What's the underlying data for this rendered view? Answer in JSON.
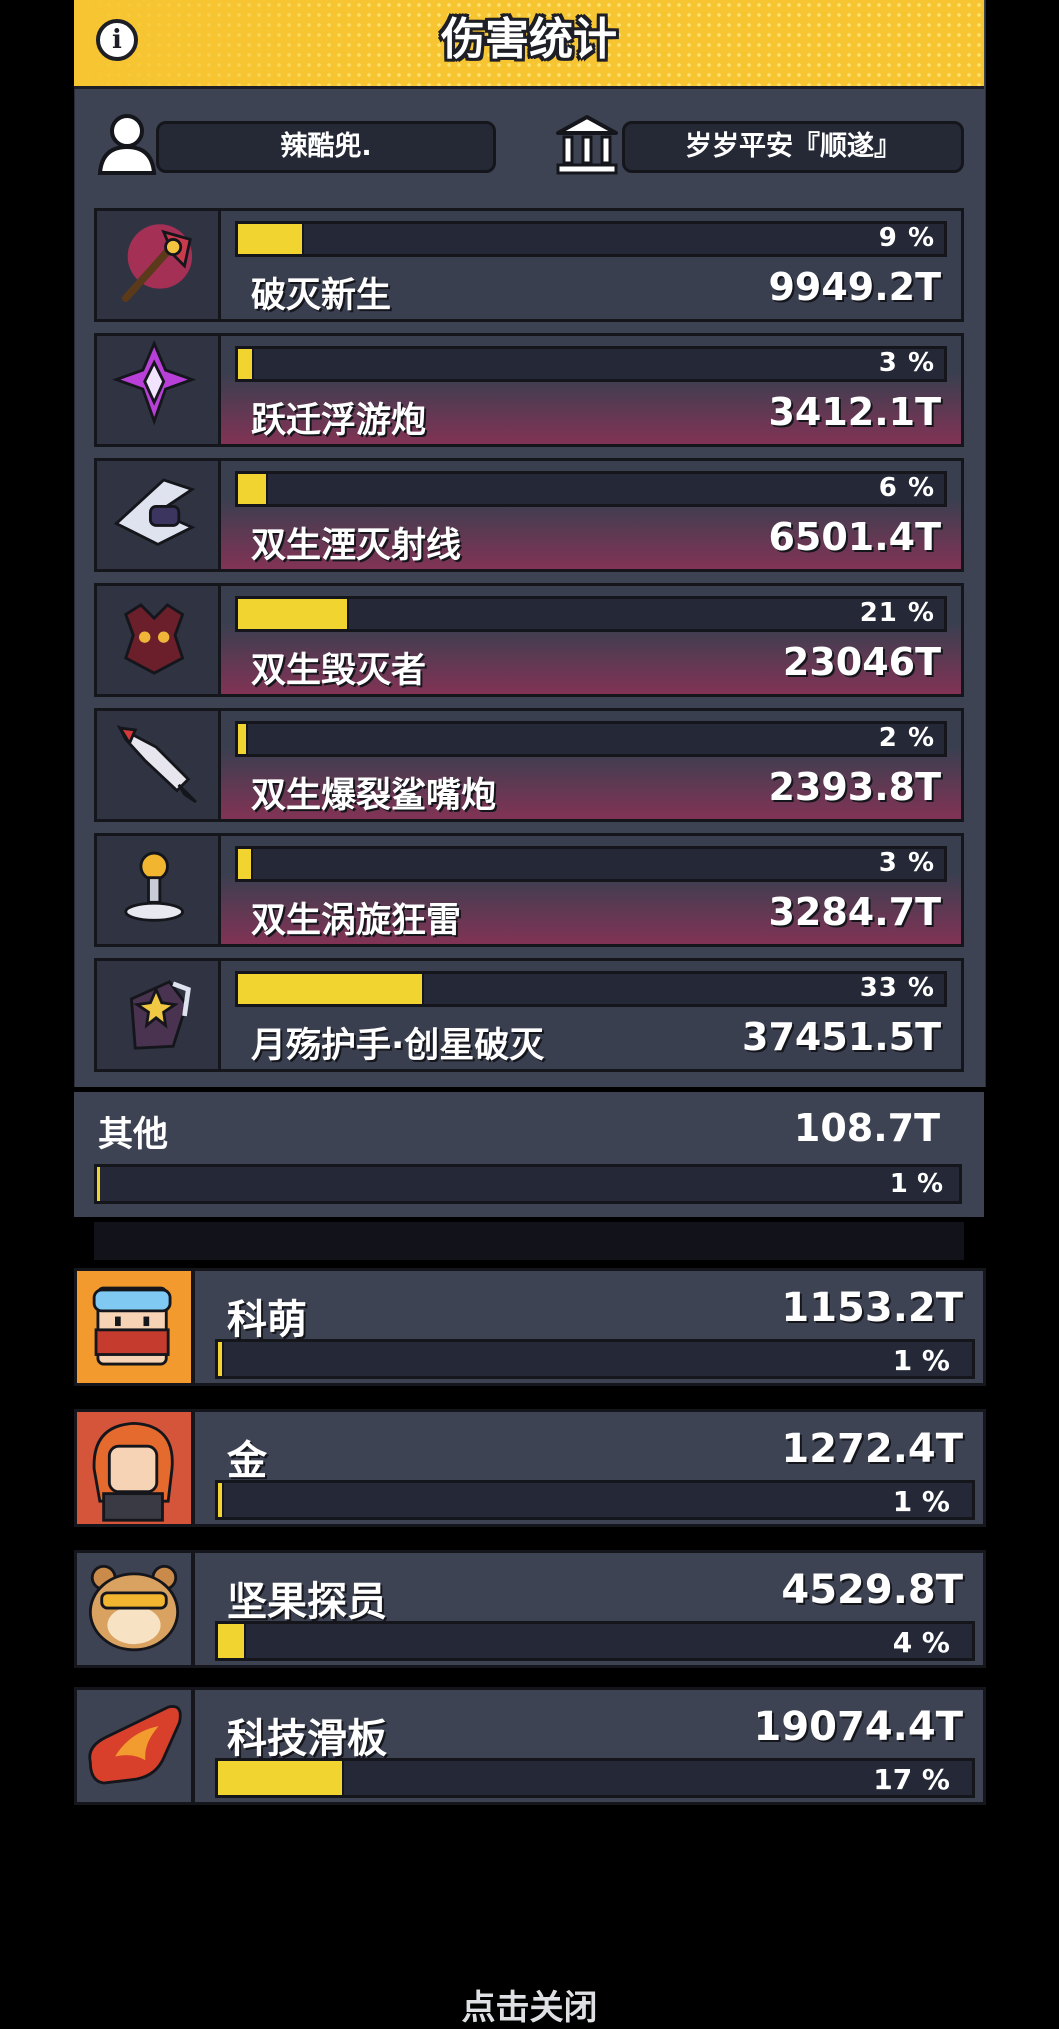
{
  "header": {
    "title": "伤害统计",
    "info_icon": "info-icon"
  },
  "player": {
    "name": "辣酷兜.",
    "guild": "岁岁平安『顺遂』"
  },
  "colors": {
    "header": "#f6c531",
    "bar_fill": "#f1d430",
    "panel": "#3e4354",
    "accent_red": "#823355"
  },
  "skills": [
    {
      "name": "破灭新生",
      "damage": "9949.2T",
      "percent_text": "9 %",
      "percent": 9,
      "icon": "axe-weapon-icon",
      "highlight": false
    },
    {
      "name": "跃迁浮游炮",
      "damage": "3412.1T",
      "percent_text": "3 %",
      "percent": 3,
      "icon": "purple-crystal-icon",
      "highlight": true
    },
    {
      "name": "双生湮灭射线",
      "damage": "6501.4T",
      "percent_text": "6 %",
      "percent": 6,
      "icon": "ray-cannon-icon",
      "highlight": true
    },
    {
      "name": "双生毁灭者",
      "damage": "23046T",
      "percent_text": "21 %",
      "percent": 21,
      "icon": "demon-drone-icon",
      "highlight": true
    },
    {
      "name": "双生爆裂鲨嘴炮",
      "damage": "2393.8T",
      "percent_text": "2 %",
      "percent": 2,
      "icon": "shark-rocket-icon",
      "highlight": true
    },
    {
      "name": "双生涡旋狂雷",
      "damage": "3284.7T",
      "percent_text": "3 %",
      "percent": 3,
      "icon": "tesla-tower-icon",
      "highlight": true
    },
    {
      "name": "月殇护手·创星破灭",
      "damage": "37451.5T",
      "percent_text": "33 %",
      "percent": 33,
      "icon": "gauntlet-icon",
      "highlight": false
    }
  ],
  "other": {
    "label": "其他",
    "damage": "108.7T",
    "percent_text": "1 %",
    "percent": 1
  },
  "allies": [
    {
      "name": "科萌",
      "damage": "1153.2T",
      "percent_text": "1 %",
      "percent": 1,
      "icon": "goggle-hero-icon",
      "bg": "#f29a2e"
    },
    {
      "name": "金",
      "damage": "1272.4T",
      "percent_text": "1 %",
      "percent": 1,
      "icon": "red-hair-hero-icon",
      "bg": "#d5553a"
    },
    {
      "name": "坚果探员",
      "damage": "4529.8T",
      "percent_text": "4 %",
      "percent": 4,
      "icon": "hamster-agent-icon",
      "bg": "#3e4354"
    },
    {
      "name": "科技滑板",
      "damage": "19074.4T",
      "percent_text": "17 %",
      "percent": 17,
      "icon": "tech-skateboard-icon",
      "bg": "#3e4354"
    }
  ],
  "footer": {
    "close_hint": "点击关闭"
  }
}
